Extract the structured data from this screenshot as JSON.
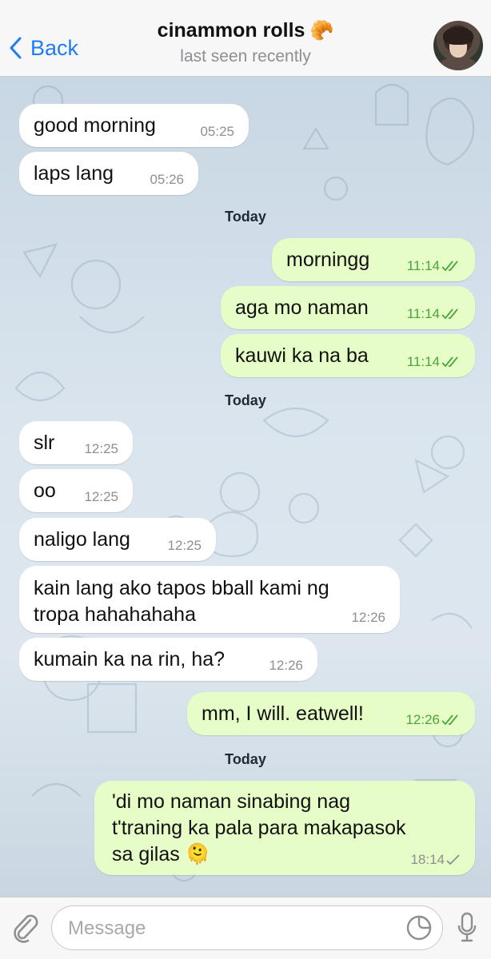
{
  "header": {
    "back_label": "Back",
    "title": "cinammon rolls",
    "title_emoji": "🥐",
    "subtitle": "last seen recently"
  },
  "messages": [
    {
      "text": "good morning",
      "time": "05:25"
    },
    {
      "text": "laps lang",
      "time": "05:26"
    },
    {
      "date": "Today"
    },
    {
      "text": "morningg",
      "time": "11:14"
    },
    {
      "text": "aga mo naman",
      "time": "11:14"
    },
    {
      "text": "kauwi ka na ba",
      "time": "11:14"
    },
    {
      "date": "Today"
    },
    {
      "text": "slr",
      "time": "12:25"
    },
    {
      "text": "oo",
      "time": "12:25"
    },
    {
      "text": "naligo lang",
      "time": "12:25"
    },
    {
      "text_line1": "kain lang ako tapos bball kami ng",
      "text_line2": "tropa hahahahaha",
      "time": "12:26"
    },
    {
      "text": "kumain ka na rin, ha?",
      "time": "12:26"
    },
    {
      "text": "mm, I will. eatwell!",
      "time": "12:26"
    },
    {
      "date": "Today"
    },
    {
      "text_line1": "'di mo naman sinabing nag",
      "text_line2": "t'traning ka pala para makapasok",
      "text_line3": "sa gilas",
      "emoji": "🫠",
      "time": "18:14"
    }
  ],
  "input": {
    "placeholder": "Message"
  },
  "colors": {
    "accent": "#1f7cf2",
    "outgoing_bubble": "#e6fdc7",
    "incoming_bubble": "#ffffff",
    "read_check": "#48a63a"
  },
  "icons": [
    "chevron-left-icon",
    "paperclip-icon",
    "sticker-icon",
    "microphone-icon",
    "double-check-icon",
    "single-check-icon"
  ]
}
